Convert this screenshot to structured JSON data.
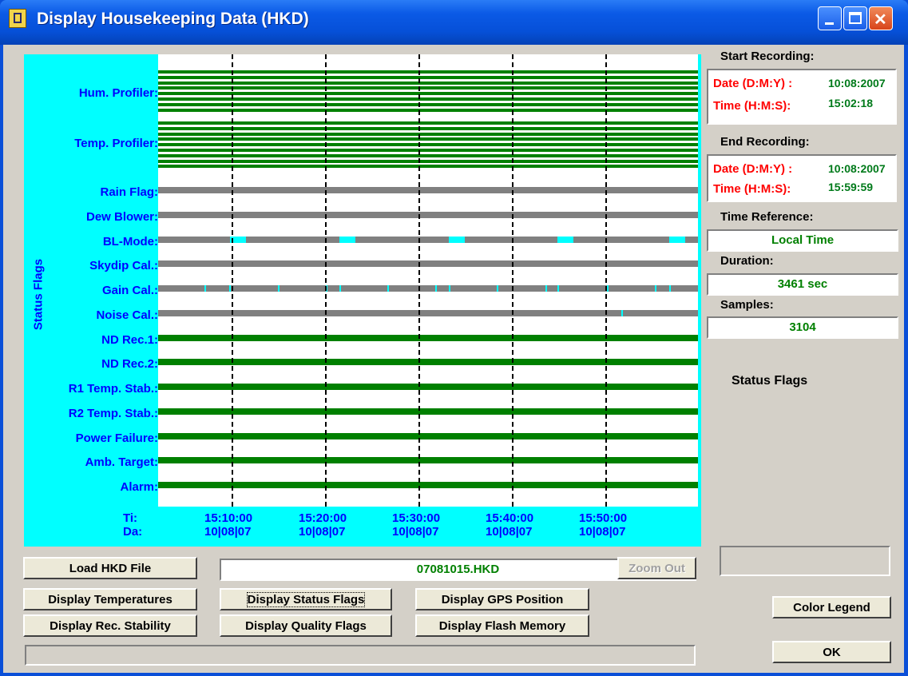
{
  "window": {
    "title": "Display Housekeeping Data (HKD)",
    "minimize_icon": "minimize-icon",
    "maximize_icon": "maximize-icon",
    "close_icon": "close-icon"
  },
  "plot": {
    "axis_title": "Status Flags",
    "profiler_rows": [
      "Hum. Profiler:",
      "Temp. Profiler:"
    ],
    "flag_rows": [
      {
        "label": "Rain Flag:",
        "color": "#808080"
      },
      {
        "label": "Dew Blower:",
        "color": "#808080"
      },
      {
        "label": "BL-Mode:",
        "color": "#808080"
      },
      {
        "label": "Skydip Cal.:",
        "color": "#808080"
      },
      {
        "label": "Gain Cal.:",
        "color": "#808080"
      },
      {
        "label": "Noise Cal.:",
        "color": "#808080"
      },
      {
        "label": "ND Rec.1:",
        "color": "#008000"
      },
      {
        "label": "ND Rec.2:",
        "color": "#008000"
      },
      {
        "label": "R1 Temp. Stab.:",
        "color": "#008000"
      },
      {
        "label": "R2 Temp. Stab.:",
        "color": "#008000"
      },
      {
        "label": "Power Failure:",
        "color": "#008000"
      },
      {
        "label": "Amb. Target:",
        "color": "#008000"
      },
      {
        "label": "Alarm:",
        "color": "#008000"
      }
    ],
    "x_row_labels": {
      "time": "Ti:",
      "date": "Da:"
    },
    "x_ticks": [
      {
        "time": "15:10:00",
        "date": "10|08|07"
      },
      {
        "time": "15:20:00",
        "date": "10|08|07"
      },
      {
        "time": "15:30:00",
        "date": "10|08|07"
      },
      {
        "time": "15:40:00",
        "date": "10|08|07"
      },
      {
        "time": "15:50:00",
        "date": "10|08|07"
      }
    ],
    "colors": {
      "background": "#00ffff",
      "plot": "#ffffff",
      "ok": "#008000",
      "inactive": "#808080",
      "active": "#00ffff"
    }
  },
  "info": {
    "start_header": "Start Recording:",
    "end_header": "End Recording:",
    "date_label": "Date (D:M:Y) :",
    "time_label": "Time (H:M:S):",
    "start_date": "10:08:2007",
    "start_time": "15:02:18",
    "end_date": "10:08:2007",
    "end_time": "15:59:59",
    "time_ref_header": "Time Reference:",
    "time_ref_value": "Local Time",
    "duration_header": "Duration:",
    "duration_value": "3461 sec",
    "samples_header": "Samples:",
    "samples_value": "3104",
    "status_flags_label": "Status Flags"
  },
  "controls": {
    "load_button": "Load HKD File",
    "file_name": "07081015.HKD",
    "zoom_out_button": "Zoom Out",
    "display_temperatures": "Display Temperatures",
    "display_status_flags": "Display Status Flags",
    "display_gps": "Display GPS Position",
    "display_rec_stability": "Display Rec. Stability",
    "display_quality_flags": "Display Quality Flags",
    "display_flash_memory": "Display Flash Memory",
    "color_legend": "Color Legend",
    "ok": "OK"
  }
}
